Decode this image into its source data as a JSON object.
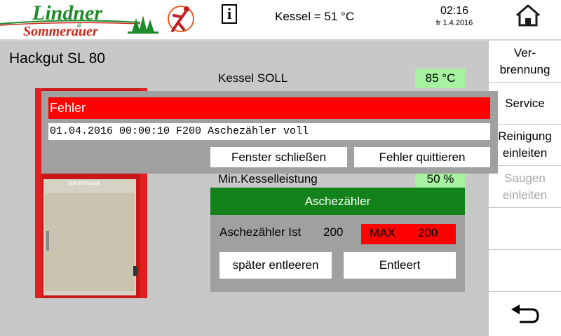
{
  "header": {
    "logo_top": "Lindner",
    "logo_amp": "&",
    "logo_bottom": "Sommerauer",
    "info_icon": "i",
    "kessel_status": "Kessel = 51 °C",
    "time": "02:16",
    "date": "fr 1.4.2016",
    "home_icon": "home-icon"
  },
  "main": {
    "title": "Hackgut SL 80",
    "boiler_brand": "Sommerauer",
    "rows": [
      {
        "label": "Kessel SOLL",
        "value": "85 °C"
      },
      {
        "label": "Min.Kesselleistung",
        "value": "50 %"
      }
    ]
  },
  "sidebar": {
    "items": [
      {
        "label": "Ver-\nbrennung",
        "enabled": true
      },
      {
        "label": "Service",
        "enabled": true
      },
      {
        "label": "Reinigung\neinleiten",
        "enabled": true
      },
      {
        "label": "Saugen\neinleiten",
        "enabled": false
      },
      {
        "label": "",
        "enabled": true
      },
      {
        "label": "",
        "enabled": true
      }
    ],
    "back_icon": "back-arrow-icon"
  },
  "asche": {
    "title": "Aschezähler",
    "ist_label": "Aschezähler Ist",
    "ist_value": "200",
    "max_label": "MAX",
    "max_value": "200",
    "later_button": "später entleeren",
    "emptied_button": "Entleert"
  },
  "dialog": {
    "title": "Fehler",
    "message": "01.04.2016 00:00:10 F200 Aschezähler voll",
    "close_button": "Fenster schließen",
    "acknowledge_button": "Fehler quittieren"
  },
  "colors": {
    "error_red": "#ff0000",
    "panel_green": "#14821a",
    "value_green": "#a6f2a0",
    "background_gray": "#c8c8c8"
  }
}
